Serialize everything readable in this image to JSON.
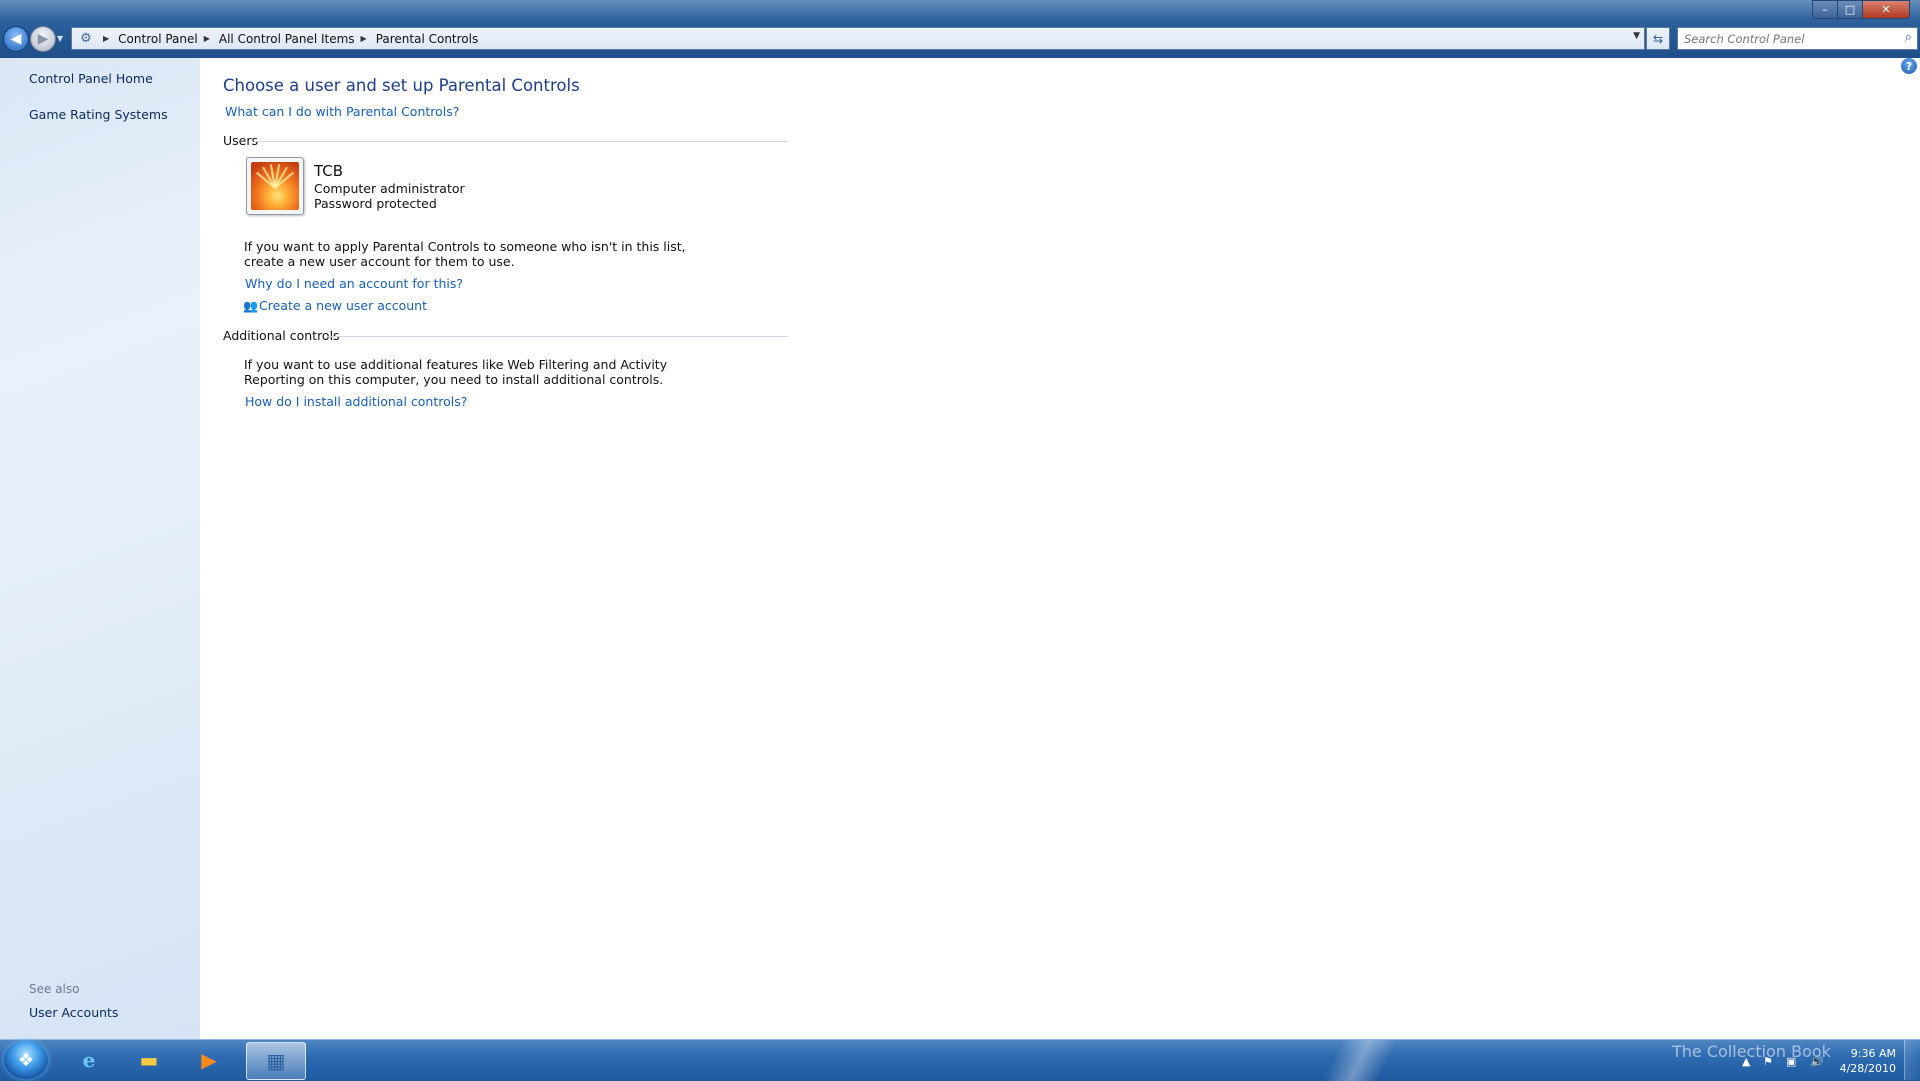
{
  "window": {
    "title": "",
    "controls": {
      "minimize": "–",
      "maximize": "□",
      "close": "✕"
    }
  },
  "nav": {
    "back_icon": "arrow-left-icon",
    "forward_icon": "arrow-right-icon",
    "breadcrumbs": [
      "Control Panel",
      "All Control Panel Items",
      "Parental Controls"
    ],
    "search_placeholder": "Search Control Panel"
  },
  "sidebar": {
    "items": [
      {
        "label": "Control Panel Home"
      },
      {
        "label": "Game Rating Systems"
      }
    ],
    "see_also_label": "See also",
    "see_also_items": [
      {
        "label": "User Accounts"
      }
    ]
  },
  "main": {
    "title": "Choose a user and set up Parental Controls",
    "what_link": "What can I do with Parental Controls?",
    "users_section": "Users",
    "user": {
      "name": "TCB",
      "role": "Computer administrator",
      "status": "Password protected"
    },
    "info_line1": "If you want to apply Parental Controls to someone who isn't in this list,",
    "info_line2": "create a new user account for them to use.",
    "why_link": "Why do I need an account for this?",
    "create_link": "Create a new user account",
    "additional_section": "Additional controls",
    "additional_line1": "If you want to use additional features like Web Filtering and Activity",
    "additional_line2": "Reporting on this computer, you need to install additional controls.",
    "install_link": "How do I install additional controls?"
  },
  "taskbar": {
    "pinned": [
      "internet-explorer-icon",
      "windows-explorer-icon",
      "media-player-icon",
      "control-panel-icon"
    ],
    "watermark": "The Collection Book",
    "time": "9:36 AM",
    "date": "4/28/2010"
  },
  "colors": {
    "link": "#1a5fb4",
    "heading": "#1e3d8a",
    "sidebar_bg": "#e2ecf8",
    "titlebar": "#2a5d99"
  }
}
